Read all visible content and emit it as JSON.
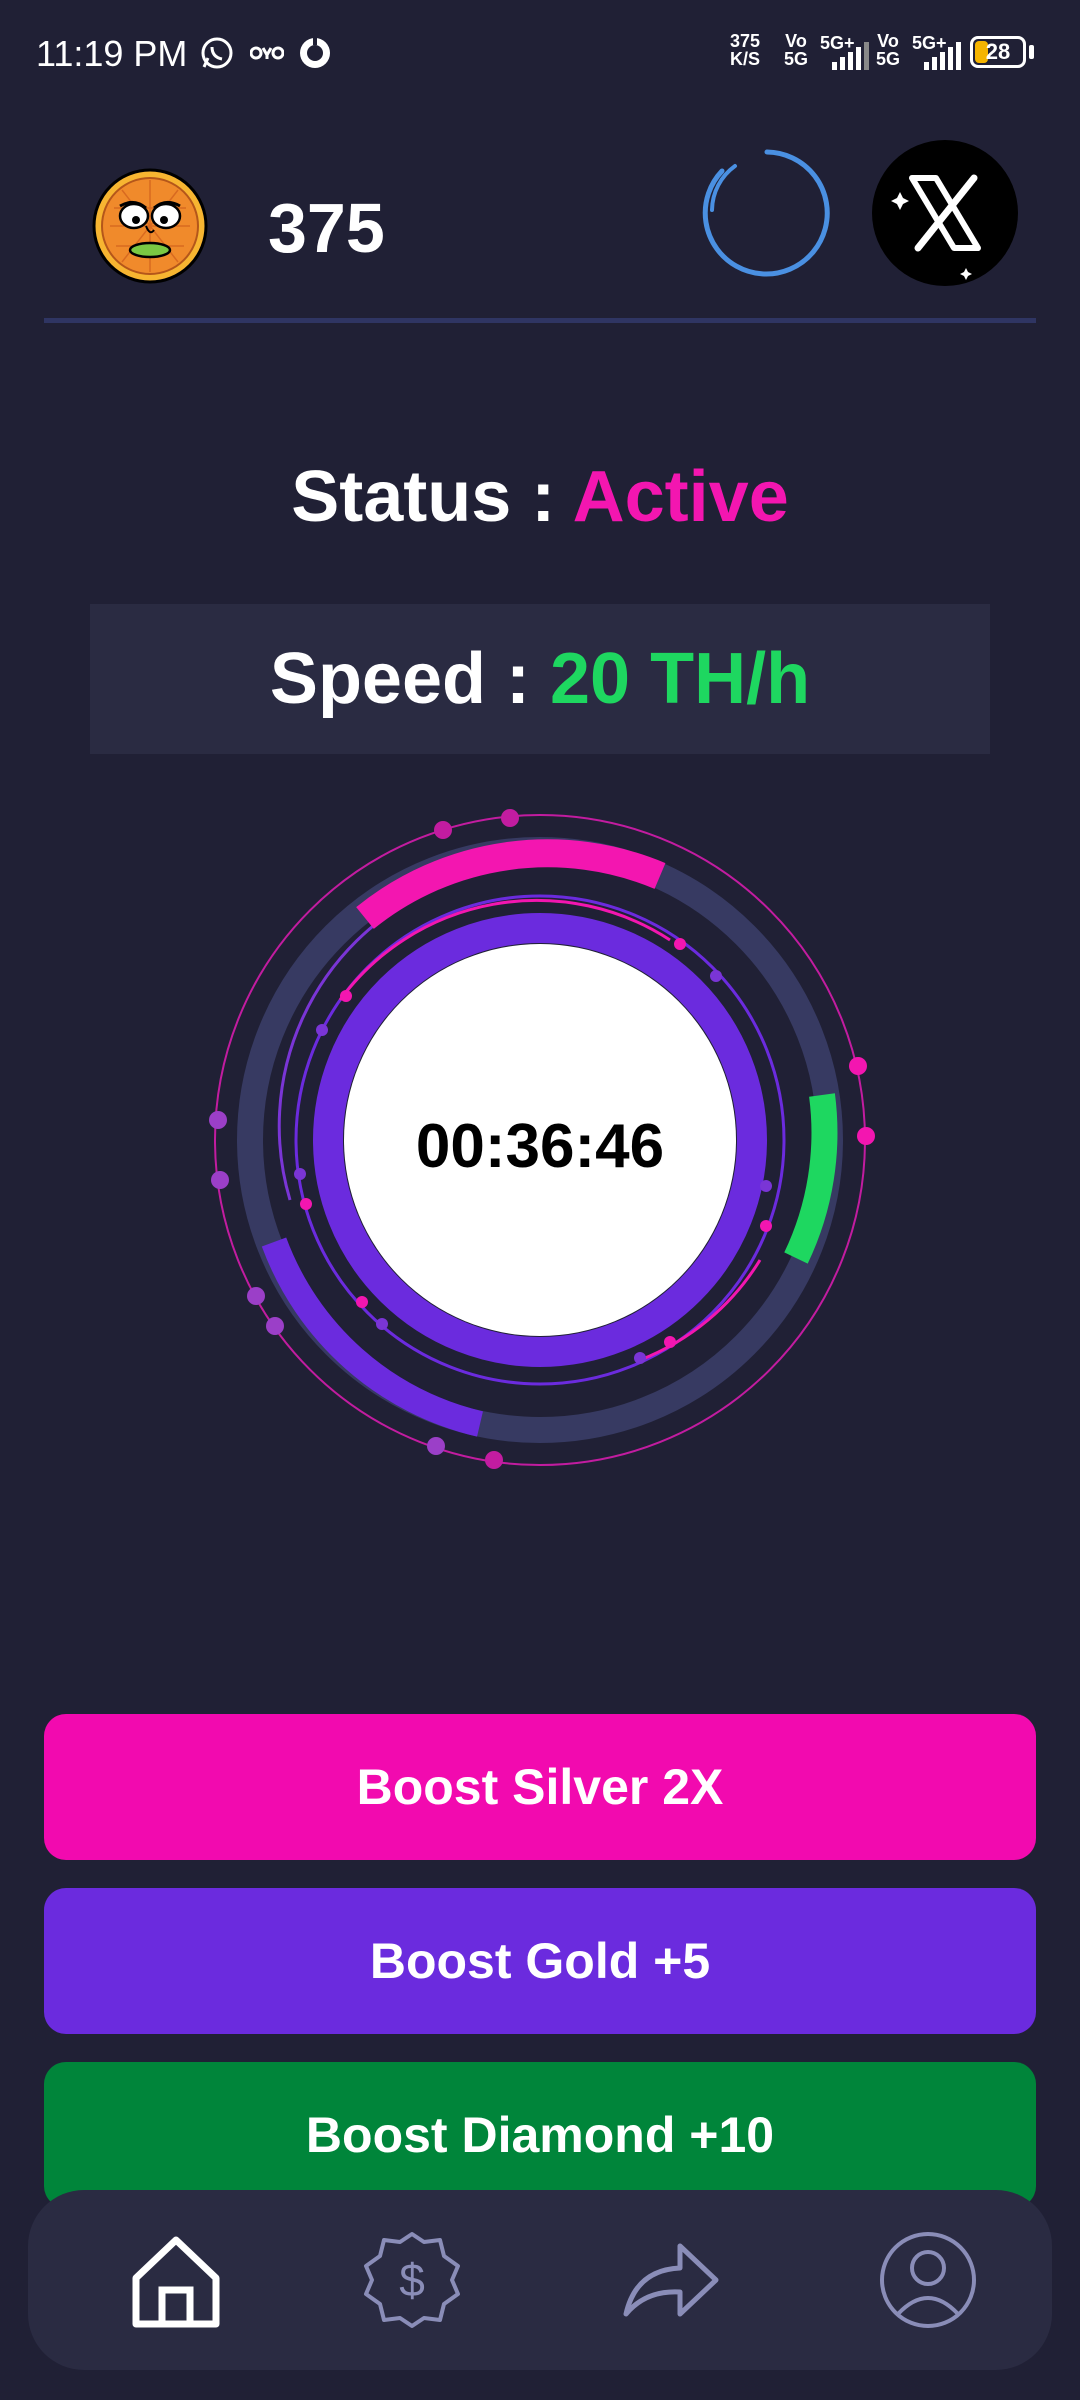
{
  "status_bar": {
    "time": "11:19 PM",
    "net_speed_value": "375",
    "net_speed_unit": "K/S",
    "sim1_top": "Vo",
    "sim1_bottom": "5G",
    "sim1_type": "5G+",
    "sim2_top": "Vo",
    "sim2_bottom": "5G",
    "sim2_type": "5G+",
    "battery": "28",
    "battery_level_percent": 28,
    "icons": [
      "whatsapp-icon",
      "oyo-icon",
      "chat-app-icon"
    ]
  },
  "header": {
    "score": "375",
    "avatar_icon": "cartoon-coin-face-avatar",
    "loading_icon": "loading-ring-icon",
    "social_icon": "x-logo-icon"
  },
  "status": {
    "label": "Status :",
    "value": "Active"
  },
  "speed": {
    "label": "Speed :",
    "value": "20 TH/h"
  },
  "timer": {
    "value": "00:36:46"
  },
  "boosts": [
    {
      "label": "Boost Silver 2X",
      "color": "#f20aaf"
    },
    {
      "label": "Boost Gold +5",
      "color": "#6b2bde"
    },
    {
      "label": "Boost Diamond +10",
      "color": "#00853a"
    }
  ],
  "nav": {
    "items": [
      "home-icon",
      "dollar-badge-icon",
      "share-arrow-icon",
      "profile-icon"
    ],
    "active": "home-icon"
  },
  "colors": {
    "background": "#202035",
    "accent_pink": "#f316b0",
    "accent_green": "#1ed760",
    "accent_purple": "#6b2bde",
    "ring_blue": "#4a90e2"
  }
}
